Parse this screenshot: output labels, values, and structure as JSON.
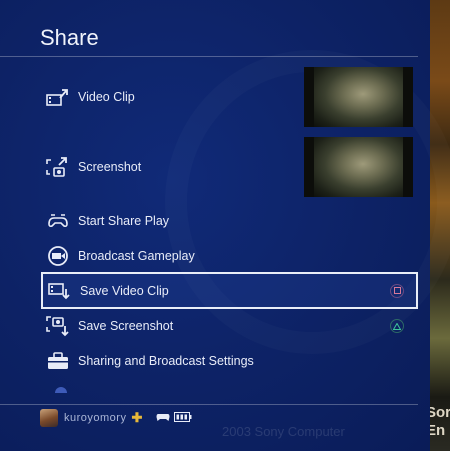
{
  "header": {
    "title": "Share"
  },
  "menu": {
    "items": [
      {
        "label": "Video Clip",
        "icon": "video-clip-share-icon"
      },
      {
        "label": "Screenshot",
        "icon": "screenshot-share-icon"
      },
      {
        "label": "Start Share Play",
        "icon": "share-play-icon"
      },
      {
        "label": "Broadcast Gameplay",
        "icon": "broadcast-icon"
      },
      {
        "label": "Save Video Clip",
        "icon": "save-video-clip-icon",
        "selected": true,
        "button_hint": "square-button-icon"
      },
      {
        "label": "Save Screenshot",
        "icon": "save-screenshot-icon",
        "button_hint": "triangle-button-icon"
      },
      {
        "label": "Sharing and Broadcast Settings",
        "icon": "toolbox-icon"
      }
    ]
  },
  "status_bar": {
    "username": "kuroyomory",
    "plus_badge": "✚",
    "controller_icon": "controller-icon",
    "battery_icon": "battery-icon"
  },
  "background_game": {
    "line1": "Sor",
    "line2": "En",
    "copyright": "2003 Sony Computer"
  },
  "colors": {
    "panel_bg": "#0d2265",
    "selection_border": "#e9eef8",
    "plus_gold": "#e7b83a",
    "square_pink": "#d87a9a",
    "triangle_green": "#3ec49a"
  }
}
